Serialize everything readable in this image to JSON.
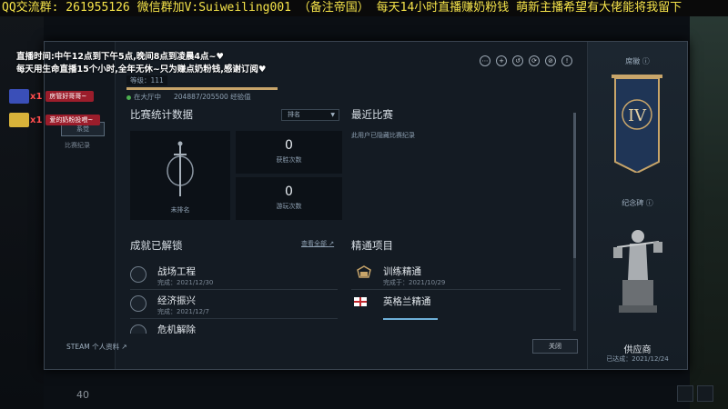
{
  "overlay": {
    "marquee": "QQ交流群: 261955126 微信群加V:Suiweiling001 （备注帝国） 每天14小时直播赚奶粉钱 萌新主播希望有大佬能将我留下",
    "schedule_line1": "直播时间:中午12点到下午5点,晚间8点到凌晨4点~♥",
    "schedule_line2": "每天用生命直播15个小时,全年无休~只为赚点奶粉钱,感谢订阅♥",
    "gifts": [
      {
        "count": "x1",
        "text": "房管好哥哥~"
      },
      {
        "count": "x1",
        "text": "爱的奶粉投喂~"
      }
    ]
  },
  "profile": {
    "level_label": "等级：111",
    "status": "在大厅中",
    "xp": "204887/205500 经验值",
    "xp_fraction": 0.997,
    "card_label": "系觉",
    "side_label": "比赛纪录"
  },
  "stats": {
    "title": "比赛统计数据",
    "filter": "排名",
    "unranked_label": "未排名",
    "wins_value": "0",
    "wins_label": "获胜次数",
    "played_value": "0",
    "played_label": "游玩次数"
  },
  "recent": {
    "title": "最近比赛",
    "empty_text": "此用户已隐藏比赛纪录"
  },
  "achievements": {
    "title": "成就已解锁",
    "view_all": "查看全部",
    "items": [
      {
        "title": "战场工程",
        "date": "完成：2021/12/30"
      },
      {
        "title": "经济振兴",
        "date": "完成：2021/12/7"
      },
      {
        "title": "危机解除",
        "date": ""
      }
    ]
  },
  "mastery": {
    "title": "精通项目",
    "items": [
      {
        "title": "训练精通",
        "date": "完成于：2021/10/29"
      },
      {
        "title": "英格兰精通",
        "date": ""
      }
    ]
  },
  "footer": {
    "steam_link": "STEAM 个人资料",
    "close_label": "关闭"
  },
  "rank": {
    "title": "席徽",
    "tier": "IV",
    "memorial_title": "纪念碑",
    "statue_name": "供应商",
    "statue_date": "已达成：2021/12/24"
  },
  "hud": {
    "resource": "40"
  },
  "colors": {
    "accent_gold": "#c8a56a",
    "dialog_bg": "#141b23",
    "marquee_text": "#f5e34a",
    "gift_tag": "#9b1d2b"
  }
}
